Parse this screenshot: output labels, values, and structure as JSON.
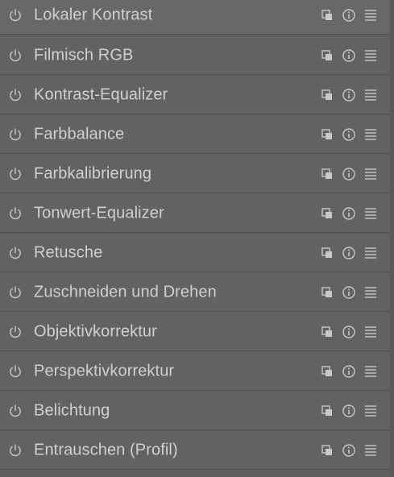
{
  "modules": [
    {
      "label": "Lokaler Kontrast"
    },
    {
      "label": "Filmisch RGB"
    },
    {
      "label": "Kontrast-Equalizer"
    },
    {
      "label": "Farbbalance"
    },
    {
      "label": "Farbkalibrierung"
    },
    {
      "label": "Tonwert-Equalizer"
    },
    {
      "label": "Retusche"
    },
    {
      "label": "Zuschneiden und Drehen"
    },
    {
      "label": "Objektivkorrektur"
    },
    {
      "label": "Perspektivkorrektur"
    },
    {
      "label": "Belichtung"
    },
    {
      "label": "Entrauschen (Profil)"
    }
  ],
  "colors": {
    "text": "#d0d0d0",
    "icon": "#c8c8c8",
    "row_background": "#626262",
    "separator": "#4f4f4f"
  },
  "icons": {
    "toggle": "power-icon",
    "duplicate": "duplicate-instance-icon",
    "info": "info-icon",
    "menu": "hamburger-menu-icon"
  }
}
